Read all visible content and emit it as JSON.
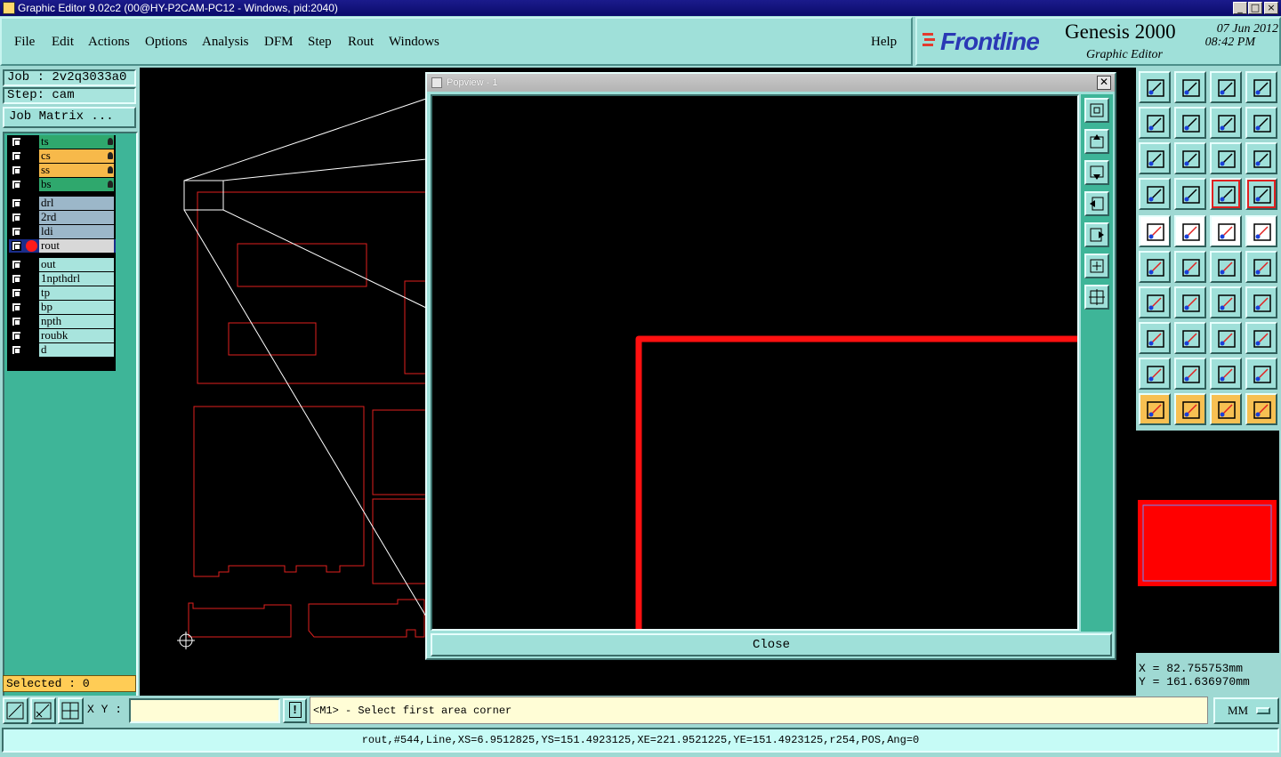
{
  "window": {
    "title": "Graphic Editor 9.02c2 (00@HY-P2CAM-PC12 - Windows, pid:2040)",
    "controls": [
      "_",
      "□",
      "×"
    ]
  },
  "menu": {
    "items": [
      "File",
      "Edit",
      "Actions",
      "Options",
      "Analysis",
      "DFM",
      "Step",
      "Rout",
      "Windows"
    ],
    "help": "Help"
  },
  "brand": {
    "logo": "Frontline",
    "product": "Genesis 2000",
    "subtitle": "Graphic Editor",
    "date": "07 Jun 2012",
    "time": "08:42 PM"
  },
  "left_panel": {
    "job": "Job : 2v2q3033a0",
    "step": "Step: cam",
    "job_matrix": "Job Matrix ...",
    "selected": "Selected : 0",
    "layers": [
      {
        "name": "ts",
        "color": "#2fa86d"
      },
      {
        "name": "cs",
        "color": "#f7b94a"
      },
      {
        "name": "ss",
        "color": "#f7b94a"
      },
      {
        "name": "bs",
        "color": "#2fa86d"
      },
      {
        "name": "drl",
        "color": "#9cb7c9"
      },
      {
        "name": "2rd",
        "color": "#9cb7c9"
      },
      {
        "name": "ldi",
        "color": "#9cb7c9"
      },
      {
        "name": "rout",
        "color": "#d8d8d8"
      },
      {
        "name": "out",
        "color": "#a8e4dd"
      },
      {
        "name": "1npthdrl",
        "color": "#a8e4dd"
      },
      {
        "name": "tp",
        "color": "#a8e4dd"
      },
      {
        "name": "bp",
        "color": "#a8e4dd"
      },
      {
        "name": "npth",
        "color": "#a8e4dd"
      },
      {
        "name": "roubk",
        "color": "#a8e4dd"
      },
      {
        "name": "d",
        "color": "#a8e4dd"
      }
    ]
  },
  "popview": {
    "title": "Popview - 1",
    "close_label": "Close"
  },
  "right_panel": {
    "x_readout": "X = 82.755753mm",
    "y_readout": "Y = 161.636970mm"
  },
  "bottom": {
    "xy_label": "X Y :",
    "xy_value": "",
    "warn": "!",
    "prompt": "<M1> - Select first area corner",
    "units": "MM",
    "status": "rout,#544,Line,XS=6.9512825,YS=151.4923125,XE=221.9521225,YE=151.4923125,r254,POS,Ang=0"
  },
  "colors": {
    "panel": "#9fd9d3",
    "canvas": "#000000",
    "rout_feature": "#ff0000",
    "layer_panel": "#3eb598"
  }
}
